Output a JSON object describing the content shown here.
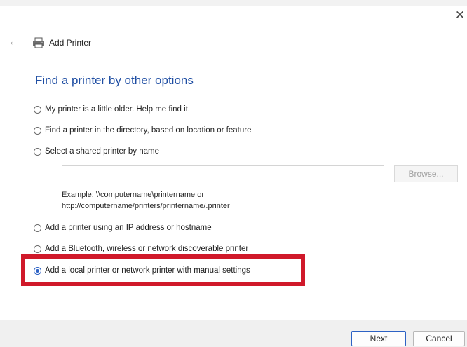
{
  "window": {
    "title": "Add Printer",
    "close_glyph": "✕",
    "back_glyph": "←"
  },
  "page": {
    "heading": "Find a printer by other options"
  },
  "options": [
    {
      "label": "My printer is a little older. Help me find it.",
      "selected": false
    },
    {
      "label": "Find a printer in the directory, based on location or feature",
      "selected": false
    },
    {
      "label": "Select a shared printer by name",
      "selected": false
    },
    {
      "label": "Add a printer using an IP address or hostname",
      "selected": false
    },
    {
      "label": "Add a Bluetooth, wireless or network discoverable printer",
      "selected": false
    },
    {
      "label": "Add a local printer or network printer with manual settings",
      "selected": true
    }
  ],
  "shared_printer": {
    "input_value": "",
    "browse_label": "Browse...",
    "example_line1": "Example: \\\\computername\\printername or",
    "example_line2": "http://computername/printers/printername/.printer"
  },
  "footer": {
    "next_label": "Next",
    "cancel_label": "Cancel"
  },
  "colors": {
    "heading": "#1f4ea3",
    "highlight": "#d0192a",
    "selected_radio": "#2d62c4"
  },
  "icons": {
    "back": "back-arrow-icon",
    "close": "close-icon",
    "printer": "printer-icon"
  }
}
